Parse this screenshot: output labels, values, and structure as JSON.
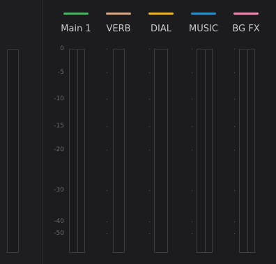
{
  "buses": [
    {
      "name": "Main 1",
      "color": "#4caf68",
      "stereo": true
    },
    {
      "name": "VERB",
      "color": "#d2a98a",
      "stereo": false
    },
    {
      "name": "DIAL",
      "color": "#e6b52c",
      "stereo": false
    },
    {
      "name": "MUSIC",
      "color": "#2d8fc2",
      "stereo": true
    },
    {
      "name": "BG FX",
      "color": "#e98db2",
      "stereo": true
    }
  ],
  "scale": [
    "0",
    "-5",
    "-10",
    "-15",
    "-20",
    "-30",
    "-40",
    "-50"
  ]
}
